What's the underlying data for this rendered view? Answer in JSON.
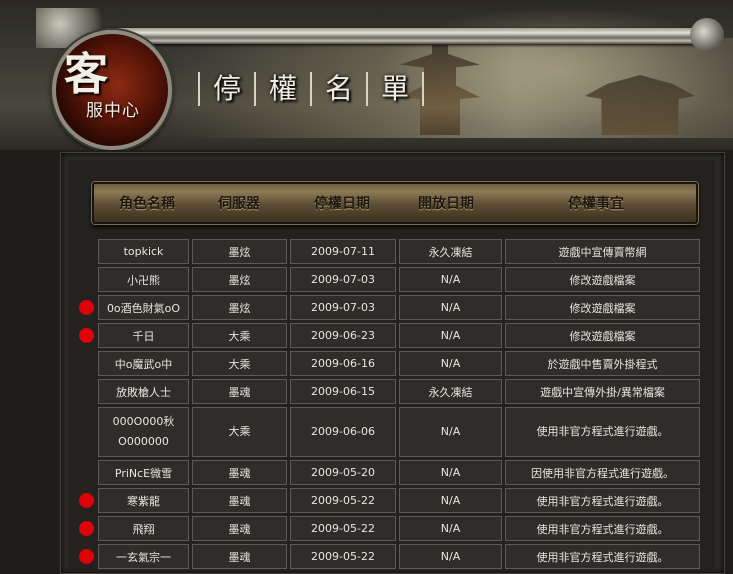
{
  "header": {
    "logo_big": "客",
    "logo_small": "服中心",
    "title_chars": [
      "停",
      "權",
      "名",
      "單"
    ]
  },
  "columns": [
    "角色名稱",
    "伺服器",
    "停權日期",
    "開放日期",
    "停權事宜"
  ],
  "rows": [
    {
      "name": "topkick",
      "server": "墨炫",
      "ban_date": "2009-07-11",
      "open_date": "永久凍結",
      "reason": "遊戲中宣傳賣幣網",
      "flag": false
    },
    {
      "name": "小卍熊",
      "server": "墨炫",
      "ban_date": "2009-07-03",
      "open_date": "N/A",
      "reason": "修改遊戲檔案",
      "flag": false
    },
    {
      "name": "0o酒色財氣oO",
      "server": "墨炫",
      "ban_date": "2009-07-03",
      "open_date": "N/A",
      "reason": "修改遊戲檔案",
      "flag": true
    },
    {
      "name": "千日",
      "server": "大乘",
      "ban_date": "2009-06-23",
      "open_date": "N/A",
      "reason": "修改遊戲檔案",
      "flag": true
    },
    {
      "name": "中o魔武o中",
      "server": "大乘",
      "ban_date": "2009-06-16",
      "open_date": "N/A",
      "reason": "於遊戲中售賣外掛程式",
      "flag": false
    },
    {
      "name": "放敗槍人士",
      "server": "墨魂",
      "ban_date": "2009-06-15",
      "open_date": "永久凍結",
      "reason": "遊戲中宣傳外掛/異常檔案",
      "flag": false
    },
    {
      "name": "000O000秋",
      "name2": "O000000",
      "server": "大乘",
      "ban_date": "2009-06-06",
      "open_date": "N/A",
      "reason": "使用非官方程式進行遊戲。",
      "flag": false
    },
    {
      "name": "PriNcE微雪",
      "server": "墨魂",
      "ban_date": "2009-05-20",
      "open_date": "N/A",
      "reason": "因使用非官方程式進行遊戲。",
      "flag": false
    },
    {
      "name": "寒紫龍",
      "server": "墨魂",
      "ban_date": "2009-05-22",
      "open_date": "N/A",
      "reason": "使用非官方程式進行遊戲。",
      "flag": true
    },
    {
      "name": "飛翔",
      "server": "墨魂",
      "ban_date": "2009-05-22",
      "open_date": "N/A",
      "reason": "使用非官方程式進行遊戲。",
      "flag": true
    },
    {
      "name": "一玄氣宗一",
      "server": "墨魂",
      "ban_date": "2009-05-22",
      "open_date": "N/A",
      "reason": "使用非官方程式進行遊戲。",
      "flag": true
    }
  ],
  "colors": {
    "flag_dot": "#e0000a"
  }
}
